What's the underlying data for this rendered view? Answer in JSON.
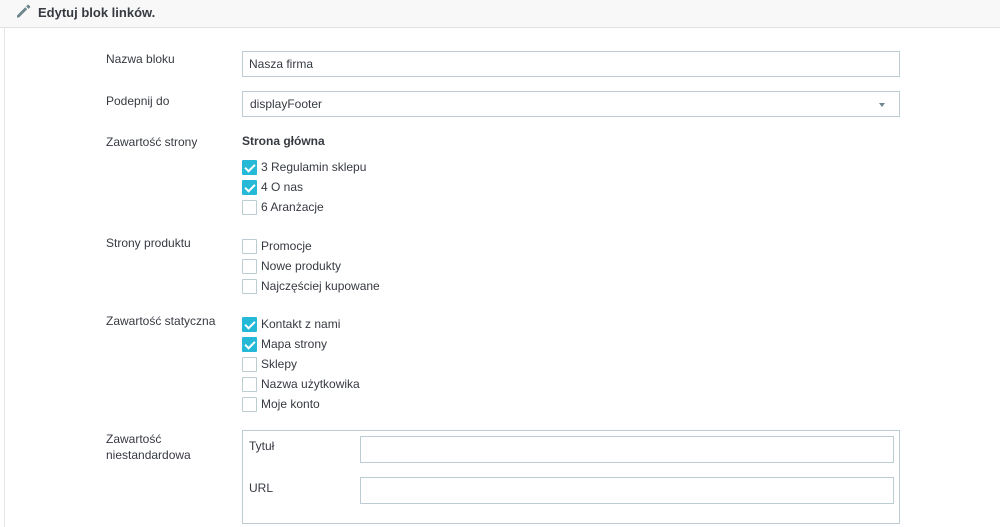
{
  "header": {
    "icon": "pencil-icon",
    "title": "Edytuj blok linków."
  },
  "form": {
    "block_name": {
      "label": "Nazwa bloku",
      "value": "Nasza firma"
    },
    "hook": {
      "label": "Podepnij do",
      "value": "displayFooter"
    },
    "page_content": {
      "label": "Zawartość strony",
      "group_title": "Strona główna",
      "items": [
        {
          "label": "3 Regulamin sklepu",
          "checked": true
        },
        {
          "label": "4 O nas",
          "checked": true
        },
        {
          "label": "6 Aranżacje",
          "checked": false
        }
      ]
    },
    "product_pages": {
      "label": "Strony produktu",
      "items": [
        {
          "label": "Promocje",
          "checked": false
        },
        {
          "label": "Nowe produkty",
          "checked": false
        },
        {
          "label": "Najczęściej kupowane",
          "checked": false
        }
      ]
    },
    "static_content": {
      "label": "Zawartość statyczna",
      "items": [
        {
          "label": "Kontakt z nami",
          "checked": true
        },
        {
          "label": "Mapa strony",
          "checked": true
        },
        {
          "label": "Sklepy",
          "checked": false
        },
        {
          "label": "Nazwa użytkowika",
          "checked": false
        },
        {
          "label": "Moje konto",
          "checked": false
        }
      ]
    },
    "custom_content": {
      "label_line1": "Zawartość",
      "label_line2": "niestandardowa",
      "title_label": "Tytuł",
      "title_value": "",
      "url_label": "URL",
      "url_value": ""
    }
  },
  "colors": {
    "accent": "#25b9d7",
    "border": "#bbcdd2",
    "text": "#363a41"
  }
}
